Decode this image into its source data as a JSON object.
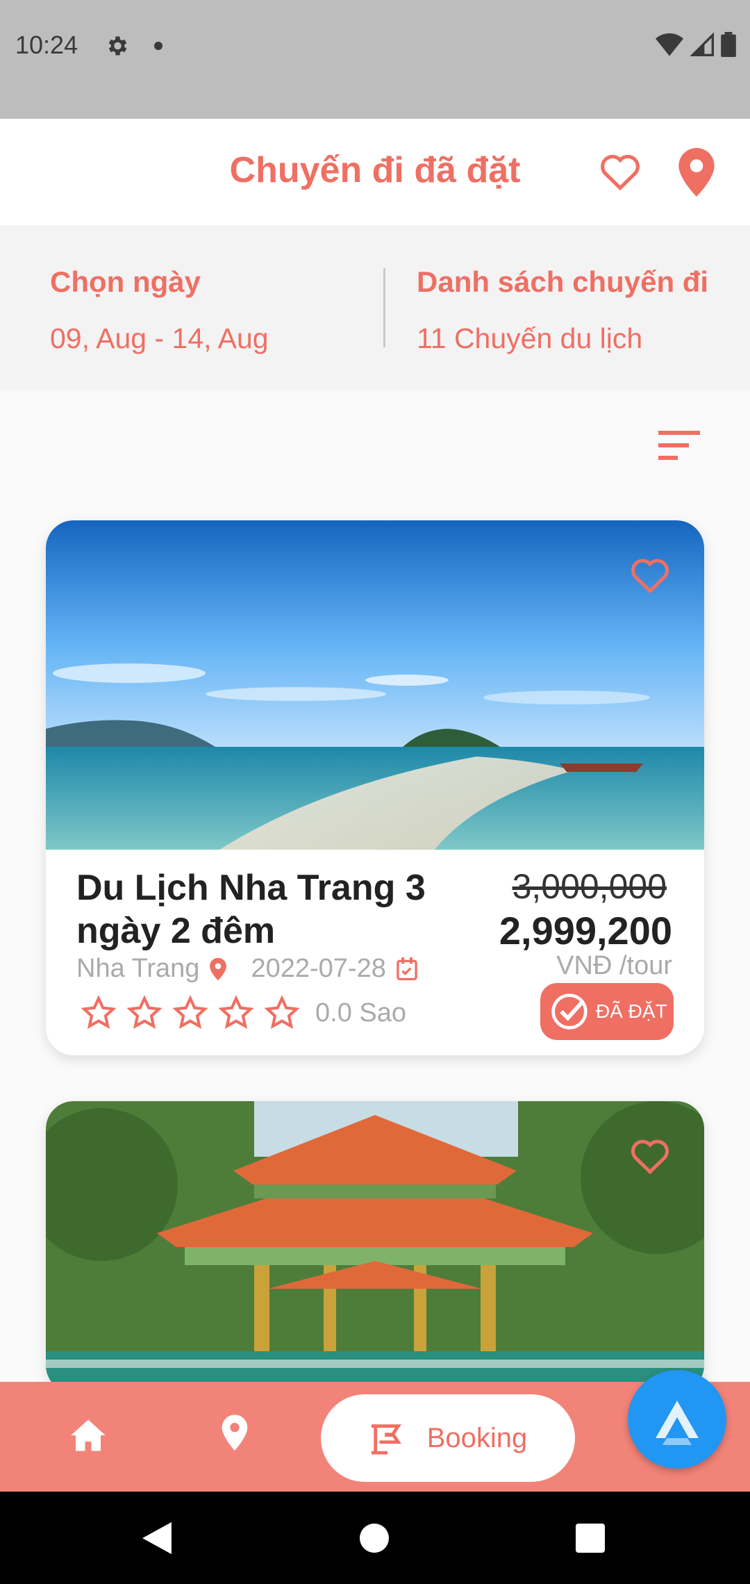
{
  "status_bar": {
    "time": "10:24"
  },
  "header": {
    "title": "Chuyến đi đã đặt"
  },
  "info": {
    "date_label": "Chọn ngày",
    "date_value": "09, Aug - 14, Aug",
    "trips_label": "Danh sách chuyến đi",
    "trips_value": "11 Chuyến du lịch"
  },
  "cards": [
    {
      "title": "Du Lịch Nha Trang 3 ngày 2 đêm",
      "old_price": "3,000,000",
      "price": "2,999,200",
      "unit": "VNĐ /tour",
      "location": "Nha Trang",
      "date": "2022-07-28",
      "rating_text": "0.0 Sao",
      "rating": 0,
      "badge": "ĐÃ ĐẶT"
    },
    {}
  ],
  "bottom_nav": {
    "booking_label": "Booking"
  },
  "colors": {
    "accent": "#ef6f63",
    "nav_bg": "#f28378",
    "fab": "#2196f3"
  },
  "icons": [
    "gear-icon",
    "wifi-icon",
    "signal-icon",
    "battery-icon",
    "heart-icon",
    "location-pin-icon",
    "filter-icon",
    "calendar-icon",
    "star-icon",
    "check-circle-icon",
    "home-icon",
    "booking-icon",
    "back-icon"
  ]
}
